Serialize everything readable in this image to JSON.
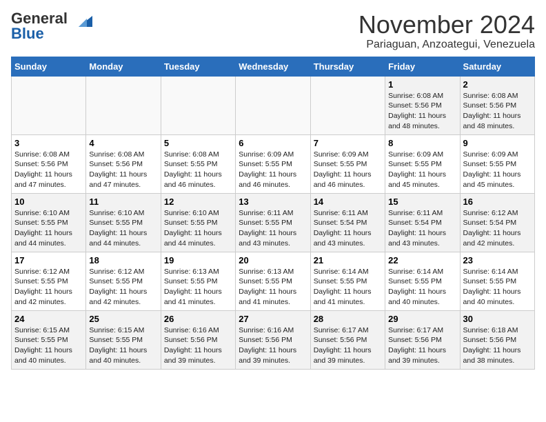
{
  "header": {
    "logo_line1": "General",
    "logo_line2": "Blue",
    "month": "November 2024",
    "location": "Pariaguan, Anzoategui, Venezuela"
  },
  "weekdays": [
    "Sunday",
    "Monday",
    "Tuesday",
    "Wednesday",
    "Thursday",
    "Friday",
    "Saturday"
  ],
  "weeks": [
    [
      {
        "day": "",
        "info": ""
      },
      {
        "day": "",
        "info": ""
      },
      {
        "day": "",
        "info": ""
      },
      {
        "day": "",
        "info": ""
      },
      {
        "day": "",
        "info": ""
      },
      {
        "day": "1",
        "info": "Sunrise: 6:08 AM\nSunset: 5:56 PM\nDaylight: 11 hours and 48 minutes."
      },
      {
        "day": "2",
        "info": "Sunrise: 6:08 AM\nSunset: 5:56 PM\nDaylight: 11 hours and 48 minutes."
      }
    ],
    [
      {
        "day": "3",
        "info": "Sunrise: 6:08 AM\nSunset: 5:56 PM\nDaylight: 11 hours and 47 minutes."
      },
      {
        "day": "4",
        "info": "Sunrise: 6:08 AM\nSunset: 5:56 PM\nDaylight: 11 hours and 47 minutes."
      },
      {
        "day": "5",
        "info": "Sunrise: 6:08 AM\nSunset: 5:55 PM\nDaylight: 11 hours and 46 minutes."
      },
      {
        "day": "6",
        "info": "Sunrise: 6:09 AM\nSunset: 5:55 PM\nDaylight: 11 hours and 46 minutes."
      },
      {
        "day": "7",
        "info": "Sunrise: 6:09 AM\nSunset: 5:55 PM\nDaylight: 11 hours and 46 minutes."
      },
      {
        "day": "8",
        "info": "Sunrise: 6:09 AM\nSunset: 5:55 PM\nDaylight: 11 hours and 45 minutes."
      },
      {
        "day": "9",
        "info": "Sunrise: 6:09 AM\nSunset: 5:55 PM\nDaylight: 11 hours and 45 minutes."
      }
    ],
    [
      {
        "day": "10",
        "info": "Sunrise: 6:10 AM\nSunset: 5:55 PM\nDaylight: 11 hours and 44 minutes."
      },
      {
        "day": "11",
        "info": "Sunrise: 6:10 AM\nSunset: 5:55 PM\nDaylight: 11 hours and 44 minutes."
      },
      {
        "day": "12",
        "info": "Sunrise: 6:10 AM\nSunset: 5:55 PM\nDaylight: 11 hours and 44 minutes."
      },
      {
        "day": "13",
        "info": "Sunrise: 6:11 AM\nSunset: 5:55 PM\nDaylight: 11 hours and 43 minutes."
      },
      {
        "day": "14",
        "info": "Sunrise: 6:11 AM\nSunset: 5:54 PM\nDaylight: 11 hours and 43 minutes."
      },
      {
        "day": "15",
        "info": "Sunrise: 6:11 AM\nSunset: 5:54 PM\nDaylight: 11 hours and 43 minutes."
      },
      {
        "day": "16",
        "info": "Sunrise: 6:12 AM\nSunset: 5:54 PM\nDaylight: 11 hours and 42 minutes."
      }
    ],
    [
      {
        "day": "17",
        "info": "Sunrise: 6:12 AM\nSunset: 5:55 PM\nDaylight: 11 hours and 42 minutes."
      },
      {
        "day": "18",
        "info": "Sunrise: 6:12 AM\nSunset: 5:55 PM\nDaylight: 11 hours and 42 minutes."
      },
      {
        "day": "19",
        "info": "Sunrise: 6:13 AM\nSunset: 5:55 PM\nDaylight: 11 hours and 41 minutes."
      },
      {
        "day": "20",
        "info": "Sunrise: 6:13 AM\nSunset: 5:55 PM\nDaylight: 11 hours and 41 minutes."
      },
      {
        "day": "21",
        "info": "Sunrise: 6:14 AM\nSunset: 5:55 PM\nDaylight: 11 hours and 41 minutes."
      },
      {
        "day": "22",
        "info": "Sunrise: 6:14 AM\nSunset: 5:55 PM\nDaylight: 11 hours and 40 minutes."
      },
      {
        "day": "23",
        "info": "Sunrise: 6:14 AM\nSunset: 5:55 PM\nDaylight: 11 hours and 40 minutes."
      }
    ],
    [
      {
        "day": "24",
        "info": "Sunrise: 6:15 AM\nSunset: 5:55 PM\nDaylight: 11 hours and 40 minutes."
      },
      {
        "day": "25",
        "info": "Sunrise: 6:15 AM\nSunset: 5:55 PM\nDaylight: 11 hours and 40 minutes."
      },
      {
        "day": "26",
        "info": "Sunrise: 6:16 AM\nSunset: 5:56 PM\nDaylight: 11 hours and 39 minutes."
      },
      {
        "day": "27",
        "info": "Sunrise: 6:16 AM\nSunset: 5:56 PM\nDaylight: 11 hours and 39 minutes."
      },
      {
        "day": "28",
        "info": "Sunrise: 6:17 AM\nSunset: 5:56 PM\nDaylight: 11 hours and 39 minutes."
      },
      {
        "day": "29",
        "info": "Sunrise: 6:17 AM\nSunset: 5:56 PM\nDaylight: 11 hours and 39 minutes."
      },
      {
        "day": "30",
        "info": "Sunrise: 6:18 AM\nSunset: 5:56 PM\nDaylight: 11 hours and 38 minutes."
      }
    ]
  ]
}
